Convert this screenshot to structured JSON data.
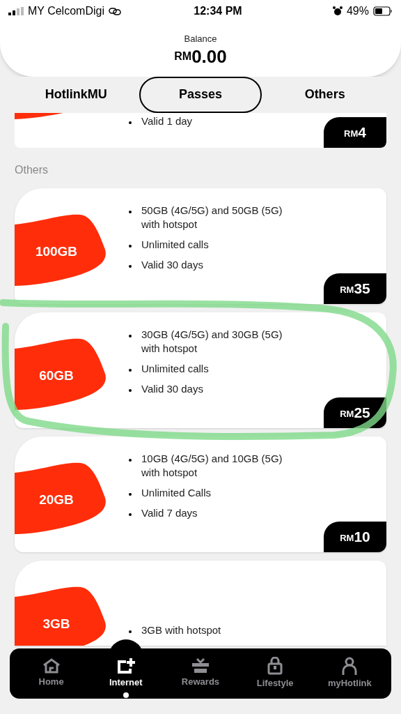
{
  "status_bar": {
    "carrier": "MY CelcomDigi",
    "time": "12:34 PM",
    "battery": "49%"
  },
  "balance": {
    "label": "Balance",
    "currency": "RM",
    "amount": "0.00"
  },
  "tabs": [
    {
      "label": "HotlinkMU",
      "selected": false
    },
    {
      "label": "Passes",
      "selected": true
    },
    {
      "label": "Others",
      "selected": false
    }
  ],
  "partial_card": {
    "features": [
      "Valid 1 day"
    ],
    "price": {
      "currency": "RM",
      "amount": "4"
    }
  },
  "section_title": "Others",
  "cards": [
    {
      "data": "100GB",
      "features": [
        "50GB (4G/5G) and 50GB (5G) with hotspot",
        "Unlimited calls",
        "Valid 30 days"
      ],
      "price": {
        "currency": "RM",
        "amount": "35"
      }
    },
    {
      "data": "60GB",
      "features": [
        "30GB (4G/5G) and 30GB (5G) with hotspot",
        "Unlimited calls",
        "Valid 30 days"
      ],
      "price": {
        "currency": "RM",
        "amount": "25"
      }
    },
    {
      "data": "20GB",
      "features": [
        "10GB (4G/5G) and 10GB (5G) with hotspot",
        "Unlimited Calls",
        "Valid 7 days"
      ],
      "price": {
        "currency": "RM",
        "amount": "10"
      }
    },
    {
      "data": "3GB",
      "features": [
        "3GB with hotspot"
      ]
    }
  ],
  "nav": [
    {
      "label": "Home",
      "selected": false
    },
    {
      "label": "Internet",
      "selected": true
    },
    {
      "label": "Rewards",
      "selected": false
    },
    {
      "label": "Lifestyle",
      "selected": false
    },
    {
      "label": "myHotlink",
      "selected": false
    }
  ]
}
